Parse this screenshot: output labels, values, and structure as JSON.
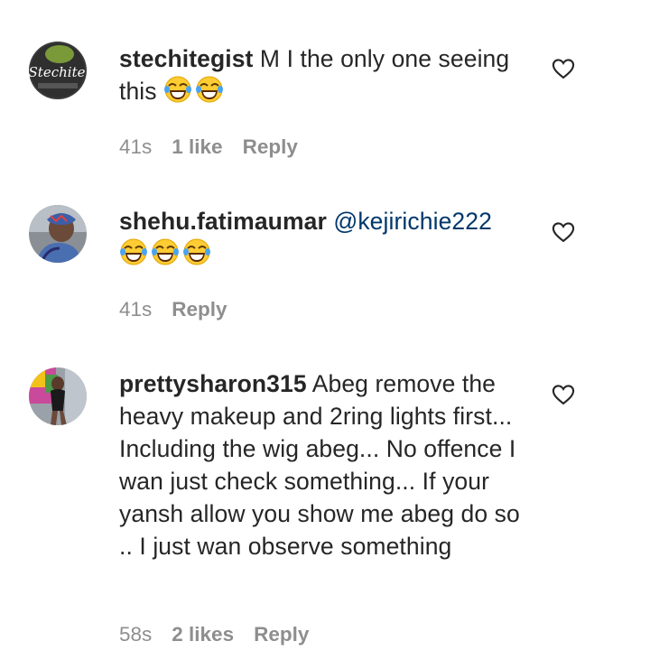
{
  "comments": [
    {
      "username": "stechitegist",
      "text": " M I the only one seeing this ",
      "emojis": [
        "face-with-tears-of-joy-icon",
        "face-with-tears-of-joy-icon"
      ],
      "time": "41s",
      "likes": "1 like",
      "reply_label": "Reply",
      "avatar_text": "Stechite"
    },
    {
      "username": "shehu.fatimaumar",
      "mention": "@kejirichie222",
      "emojis": [
        "face-with-tears-of-joy-icon",
        "face-with-tears-of-joy-icon",
        "face-with-tears-of-joy-icon"
      ],
      "time": "41s",
      "reply_label": "Reply"
    },
    {
      "username": "prettysharon315",
      "text": " Abeg remove the heavy makeup and 2ring lights first... Including the wig abeg... No offence I wan just check something... If your yansh allow you show me abeg do so .. I just wan observe something",
      "time": "58s",
      "likes": "2 likes",
      "reply_label": "Reply"
    }
  ],
  "colors": {
    "mention": "#00376b",
    "meta": "#8e8e8e",
    "text": "#262626"
  }
}
